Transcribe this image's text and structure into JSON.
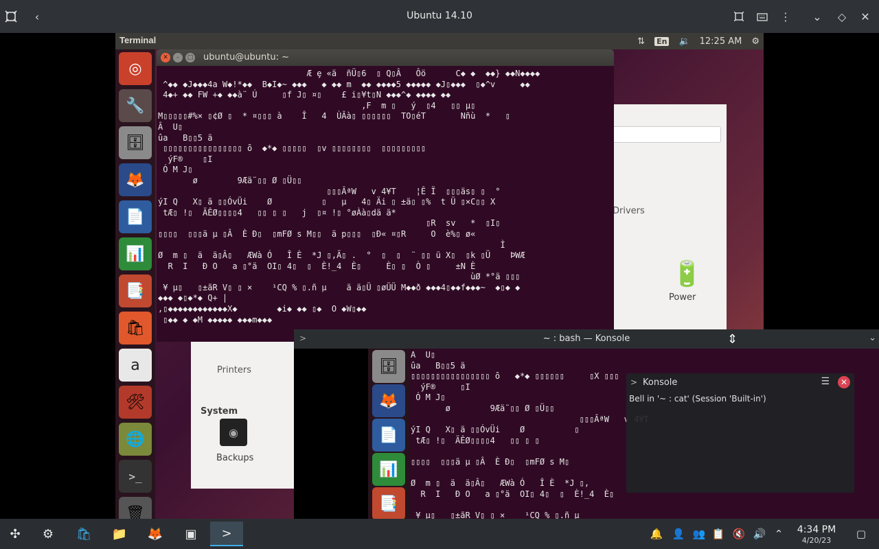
{
  "viewer": {
    "title": "Ubuntu 14.10",
    "icons": [
      "app-logo-icon",
      "back-icon",
      "fullscreen-icon",
      "keyboard-icon",
      "more-icon",
      "chevron-down-icon",
      "diamond-icon"
    ]
  },
  "ubuntu": {
    "panel_title": "Terminal",
    "keyboard_layout": "En",
    "clock": "12:25 AM",
    "launcher_items": [
      "ubuntu-dash",
      "system-settings-app",
      "files-app",
      "firefox-app",
      "writer-app",
      "calc-app",
      "impress-app",
      "software-center-app",
      "amazon-app",
      "system-tools-app",
      "workspaces-app",
      "terminal-app",
      "trash-app"
    ]
  },
  "terminal": {
    "title": "ubuntu@ubuntu: ~",
    "lines": [
      "                              Æ ȩ «ä  ñÜ▯6  ▯ Q▯Â   Ôö      C◆ ◆  ◆◆} ◆◆N◆◆◆◆",
      " ^◆◆ ◆J◆◆◆4a W◆!*◆◆  B◆I◆~ ◆◆◆   ◆ ◆◆ m  ◆◆ ◆◆◆◆5 ◆◆◆◆◆ ◆J▯◆◆◆  ▯◆^v     ◆◆",
      " 4◆+ ◆◆ FW +◆ ◆◆à¨ Ú     ▯f J▯ ¤▯    £ i▯¥t▯N ◆◆◆^◆ ◆◆◆◆ ◆◆",
      "                                         ,F  m ▯   ý  ▯4   ▯▯ µ▯",
      "M▯▯▯▯▯#%× ▯¢Ø ▯  * ¤▯▯▯ à    Î   4  ÙÂà▯ ▯▯▯▯▯▯  TO▯éT       Nñù  *   ▯",
      "Â  U▯",
      "ûa   B▯▯5 ä",
      " ▯▯▯▯▯▯▯▯▯▯▯▯▯▯▯▯ ȏ  ◆*◆ ▯▯▯▯▯  ▯v ▯▯▯▯▯▯▯▯  ▯▯▯▯▯▯▯▯▯",
      "  ýF®    ▯I",
      " Ó M J▯",
      "       ø        9Æä¨▯▯ Ø ▯Ü▯▯",
      "                                  ▯▯▯ÂªW   v 4¥T    ¦Ê Ï  ▯▯▯äs▯ ▯  °",
      "ýI Q   X▯ ä ▯▯ÓvÜi    Ø          ▯   µ   4▯ Äi ▯ ±ä▯ ▯%  t Ü ▯×C▯▯ X",
      " tÆ▯ !▯  ÄÊØ▯▯▯▯4   ▯▯ ▯ ▯   j  ▯¤ !▯ °øÀà▯dä ä*",
      "                                                      ▯R  sv   *  ▯I▯",
      "▯▯▯▯  ▯▯▯ä µ ▯Â  È Ð▯  ▯mFØ s M▯▯  ä p▯▯▯  ▯Ð« ¤▯R     O  è%▯ ø«",
      "                                                                     Ì",
      "Ø  m ▯  ä  ä▯Â▯   ÆWà Ó   Î È  *J ▯,Ä▯ .  °  ▯  ▯  ¨ ▯▯ ü X▯  ▯k ▯Ü    ÞWÆ",
      "  R  I   Ð O   a ▯°ä  OI▯ 4▯  ▯  È!_4  È▯     È▯ ▯  Ò ▯     ±N È",
      "                                                               ùØ *°ä ▯▯▯",
      " ¥ µ▯   ▯±ãR V▯ ▯ ×    ¹CQ % ▯.ñ µ    ä ä▯Ü ▯øÜÜ M◆◆ð ◆◆◆4▯◆◆f◆◆◆~  ◆▯◆ ◆",
      "◆◆◆ ◆▯◆*◆ Q+ |",
      ",▯◆◆◆◆◆◆◆◆◆◆◆◆X◆        ◆i◆ ◆◆ ▯◆  O ◆W▯◆◆",
      " ▯◆◆ ◆ ◆M ◆◆◆◆◆ ◆◆◆m◆◆◆"
    ]
  },
  "settings": {
    "printers_label": "Printers",
    "system_label": "System",
    "backups_label": "Backups",
    "drivers_label": "Drivers",
    "power_label": "Power"
  },
  "konsole": {
    "title": "~ : bash — Konsole",
    "lines": [
      "A  U▯",
      "ûa   B▯▯5 ä",
      "▯▯▯▯▯▯▯▯▯▯▯▯▯▯▯▯ ȏ   ◆*◆ ▯▯▯▯▯▯     ▯X ▯▯▯",
      "  ýF®     ▯I",
      " Ó M J▯",
      "       ø        9Æä¨▯▯ Ø ▯Ü▯▯",
      "                                  ▯▯▯ÂªW   v 4¥T",
      "ýI Q   X▯ ä ▯▯ÓvÜi    Ø          ▯",
      " tÆ▯ !▯  ÄÊØ▯▯▯▯4   ▯▯ ▯ ▯",
      "",
      "▯▯▯▯  ▯▯▯ä µ ▯Â  È Ð▯  ▯mFØ s M▯",
      "",
      "Ø  m ▯  ä  ä▯Â▯   ÆWà Ó   Î È  *J ▯,",
      "  R  I   Ð O   a ▯°ä  OI▯ 4▯  ▯  È!_4  È▯",
      "",
      " ¥ µ▯   ▯±ãR V▯ ▯ ×    ¹CQ % ▯.ñ µ"
    ]
  },
  "notification": {
    "title": "Konsole",
    "body": "Bell in '~ : cat' (Session 'Built-in')"
  },
  "taskbar": {
    "time": "4:34 PM",
    "date": "4/20/23"
  }
}
